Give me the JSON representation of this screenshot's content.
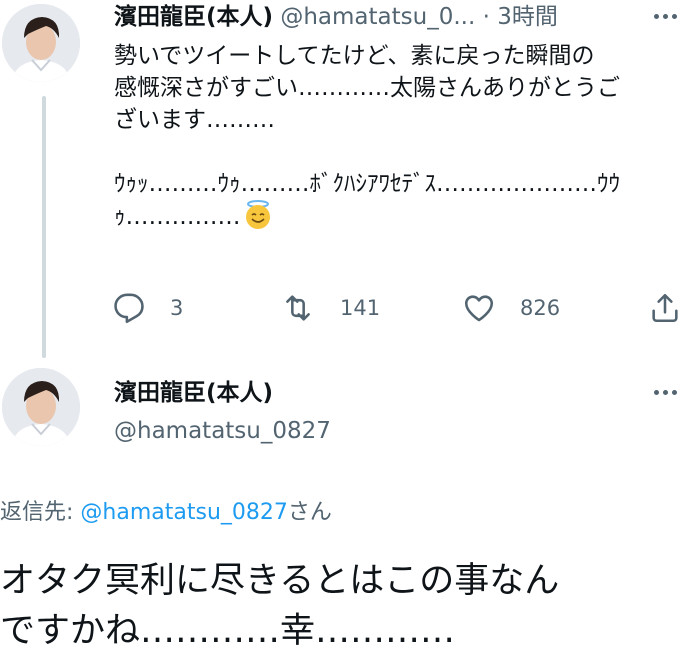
{
  "tweet1": {
    "author_name": "濱田龍臣(本人)",
    "handle": "@hamatatsu_0...",
    "time": "· 3時間",
    "avatar_icon": "profile-photo",
    "text": "勢いでツイートしてたけど、素に戻った瞬間の\n感慨深さがすごい…………太陽さんありがとうご\nざいます………\n\nｳｩｯ………ｳｩ………ﾎﾞｸﾊｼｱﾜｾﾃﾞｽ…………………ｳｳ\nｩ……………",
    "emoji": "smiling-face-with-halo",
    "replies_count": "3",
    "retweets_count": "141",
    "likes_count": "826",
    "icons": {
      "reply": "reply-icon",
      "retweet": "retweet-icon",
      "like": "heart-icon",
      "share": "share-icon",
      "more": "more-icon"
    }
  },
  "tweet2": {
    "author_name": "濱田龍臣(本人)",
    "handle": "@hamatatsu_0827",
    "avatar_icon": "profile-photo",
    "reply_to_label": "返信先: ",
    "reply_to_handle": "@hamatatsu_0827",
    "reply_to_suffix": "さん",
    "text": "オタク冥利に尽きるとはこの事なん\nですかね…………幸…………"
  },
  "colors": {
    "text": "#0f1419",
    "secondary": "#536471",
    "link": "#1d9bf0",
    "thread_line": "#cfd9de"
  }
}
